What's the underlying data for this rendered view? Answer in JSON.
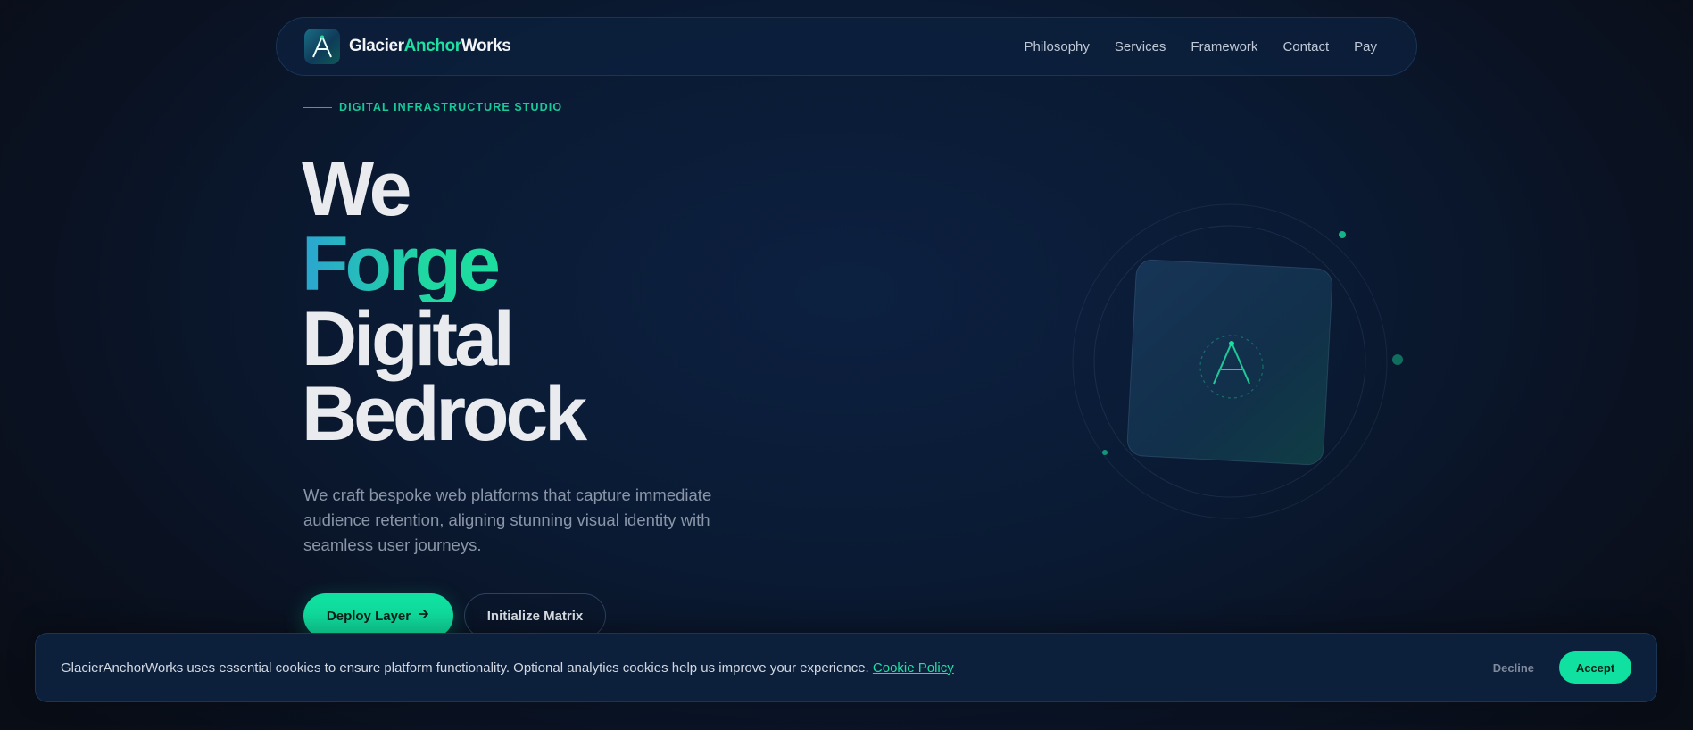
{
  "brand": {
    "part1": "Glacier",
    "part2": "Anchor",
    "part3": "Works",
    "logo_icon": "anchor-a-logo-icon",
    "accent_color": "#1fe0a3"
  },
  "nav": {
    "links": [
      "Philosophy",
      "Services",
      "Framework",
      "Contact",
      "Pay"
    ]
  },
  "hero": {
    "eyebrow": "DIGITAL INFRASTRUCTURE STUDIO",
    "headline": [
      "We",
      "Forge",
      "Digital",
      "Bedrock"
    ],
    "subtitle": "We craft bespoke web platforms that capture immediate audience retention, aligning stunning visual identity with seamless user journeys.",
    "primary_cta": "Deploy Layer",
    "primary_cta_icon": "arrow-right-icon",
    "secondary_cta": "Initialize Matrix"
  },
  "cookie": {
    "text": "GlacierAnchorWorks uses essential cookies to ensure platform functionality. Optional analytics cookies help us improve your experience.",
    "policy_link": "Cookie Policy",
    "decline": "Decline",
    "accept": "Accept"
  },
  "colors": {
    "accent": "#10e0a0",
    "background": "#0a1a33",
    "gradient_start": "#2ba4d1"
  }
}
